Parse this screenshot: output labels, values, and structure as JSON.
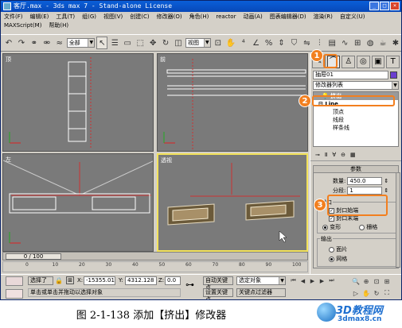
{
  "window": {
    "title": "客厅.max - 3ds max 7 - Stand-alone License",
    "btn_min": "_",
    "btn_max": "□",
    "btn_close": "×"
  },
  "menu": {
    "row1": [
      "文件(F)",
      "编辑(E)",
      "工具(T)",
      "组(G)",
      "视图(V)",
      "创建(C)",
      "修改器(O)",
      "角色(H)",
      "reactor",
      "动画(A)",
      "图表编辑器(D)",
      "渲染(R)",
      "自定义(U)"
    ],
    "row2": [
      "MAXScript(M)",
      "帮助(H)"
    ]
  },
  "toolbar": {
    "selection_filter": "全部",
    "ref_coord": "视图"
  },
  "viewports": {
    "top": "顶",
    "front": "前",
    "left": "左",
    "perspective": "透视"
  },
  "command_panel": {
    "object_name": "抽屉01",
    "object_color": "#6b3ed0",
    "modifier_list": "修改器列表",
    "stack": {
      "extrude": "挤出",
      "line": "Line",
      "vertex": "顶点",
      "segment": "线段",
      "spline": "样条线"
    },
    "params": {
      "title": "参数",
      "amount_label": "数量:",
      "amount_value": "450.0",
      "segments_label": "分段:",
      "segments_value": "1",
      "capping_title": "封口",
      "cap_start": "封口始端",
      "cap_end": "封口末端",
      "morph": "变形",
      "grid": "栅格",
      "output_title": "输出",
      "patch": "面片",
      "mesh": "网格"
    },
    "callouts": [
      "1",
      "2",
      "3"
    ]
  },
  "timeline": {
    "frame_display": "0 / 100",
    "ticks": [
      "0",
      "10",
      "20",
      "30",
      "40",
      "50",
      "60",
      "70",
      "80",
      "90",
      "100"
    ]
  },
  "status": {
    "selection": "选择了",
    "x_label": "X:",
    "x_value": "-15355.01",
    "y_label": "Y:",
    "y_value": "4312.128",
    "z_label": "Z:",
    "z_value": "0.0",
    "auto_key": "自动关键点",
    "set_key": "设置关键点",
    "selected_object": "选定对象",
    "key_filters": "关键点过滤器",
    "prompt": "单击或单击并拖动以选择对象"
  },
  "caption": "图 2-1-138   添加【挤出】修改器",
  "watermark": {
    "name": "3D教程网",
    "url": "3dmax8.cn"
  },
  "colors": {
    "title_blue": "#0a5fd8",
    "callout_orange": "#f27f1f",
    "active_viewport": "#f3e25a",
    "viewport_gray": "#7a7a7a"
  }
}
